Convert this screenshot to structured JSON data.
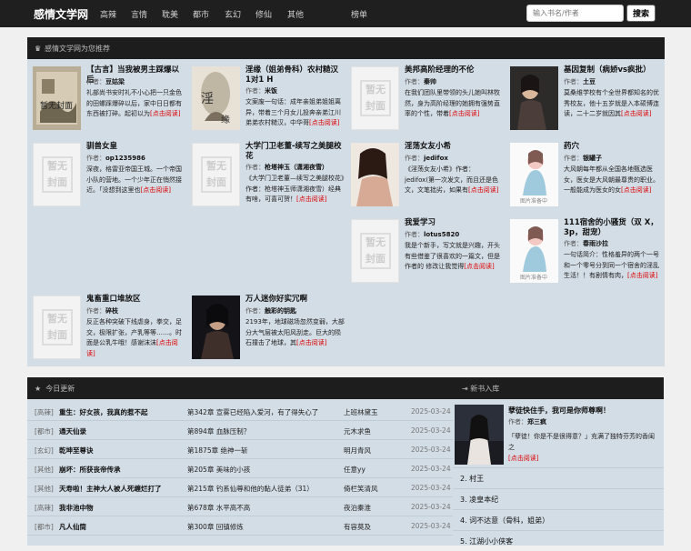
{
  "site": {
    "logo": "感情文学网"
  },
  "nav": [
    "高辣",
    "言情",
    "耽美",
    "都市",
    "玄幻",
    "修仙",
    "其他",
    "榜单"
  ],
  "search": {
    "placeholder": "输入书名/作者",
    "button": "搜索"
  },
  "recommend": {
    "heading": "感情文学网为您推荐",
    "author_label": "作者：",
    "more_label": "[点击阅读]",
    "placeholder_cover": "暂无封面",
    "books": [
      {
        "title": "【古言】当我被男主踩爆以后",
        "author": "豆姑梁",
        "desc": "礼部尚书安时礼不小心把一只金色的田螺踩爆碎以后，家中日日都有东西被打碎。起初以为",
        "cover": "drawing"
      },
      {
        "title": "淫缘（姐弟骨科）农村糙汉 1对1 H",
        "author": "米饭",
        "desc": "文案废一句话：成年亲姐弟姐姐离异，带着三个月女儿投奔亲弟江川弟弟农村糙汉，中华哥",
        "cover": "portrait"
      },
      {
        "title": "美邦高阶经理的不伦",
        "author": "秦帅",
        "desc": "在我们团队里带领的头儿她叫林牧然，身为高阶经理的她拥有强势直率的个性，带着",
        "cover": "placeholder"
      },
      {
        "title": "基因复制（病娇vs疯批）",
        "author": "土豆",
        "desc": "莫桑维学校有个全世界都知名的优秀校友，他十五岁就是入本硕博连读，二十二岁就因其",
        "cover": "photo"
      },
      {
        "title": "驯兽女皇",
        "author": "op1235986",
        "desc": "深夜，格雷亚帝国王城。一个帝国小队的营地。一个少年正在悄然接近。「没想到这里也",
        "cover": "placeholder"
      },
      {
        "title": "大学门卫老董-续写之美腿校花",
        "author": "枪塔神玉（潇湘夜雪）",
        "desc": "《大学门卫老董—续写之美腿校花》作者：枪塔神玉师潇湘夜雪）经典有啥，可喜可贺！",
        "cover": "placeholder"
      },
      {
        "title": "淫荡女友小希",
        "author": "jedifox",
        "desc": "《淫荡女友小希》作者：jedifox(第一次发文，而且还是色文，文笔拙劣，如果有",
        "cover": "photo2"
      },
      {
        "title": "药穴",
        "author": "银罐子",
        "desc": "大风朝每年都从全国各地甄选医女，医女是大风朝最尊贵的职业。一般能成为医女的女",
        "cover": "pending"
      },
      {
        "title": "我爱学习",
        "author": "lotus5820",
        "desc": "我是个新手，写文就是兴趣，开头有些借鉴了很喜欢的一篇文，但是作者的 修改让我觉得",
        "cover": "placeholder"
      },
      {
        "title": "111宿舍的小骚货（双 X，3p，甜宠）",
        "author": "春雨沙拉",
        "desc": "一句话简介：性格羞异的两个一号和一个零号分到同一个宿舍的淫乱生活！！有剧情有肉，",
        "cover": "pending"
      },
      {
        "title": "鬼畜重口堆放区",
        "author": "碎枝",
        "desc": "反正各种突破下线虐身，拳交，足交，极限扩张，产乳等等……。时面是公乳牛哦！感谢沫沫",
        "cover": "placeholder"
      },
      {
        "title": "万人迷你好实冗啊",
        "author": "触彩的钥匙",
        "desc": "2193年，地球磁场忽然变弱，大部分大气层被太阳风刮走。巨大的陨石撞击了地球，其",
        "cover": "dark"
      }
    ]
  },
  "today": {
    "heading": "今日更新",
    "rows": [
      {
        "cat": "[高辣]",
        "title": "重生：好女孩，我真的惹不起",
        "chapter": "第342章 宣雾已经陷入爱河，有了得失心了",
        "author": "上班林黛玉",
        "date": "2025-03-24"
      },
      {
        "cat": "[都市]",
        "title": "通天仙录",
        "chapter": "第894章 血脉压制？",
        "author": "元木求鱼",
        "date": "2025-03-24"
      },
      {
        "cat": "[玄幻]",
        "title": "乾坤至尊诀",
        "chapter": "第1875章 绝神一斩",
        "author": "明月青风",
        "date": "2025-03-24"
      },
      {
        "cat": "[其他]",
        "title": "崩坏：所获丧帝传承",
        "chapter": "第205章 美味的小孩",
        "author": "任意yy",
        "date": "2025-03-24"
      },
      {
        "cat": "[其他]",
        "title": "天寿啦！主神大人被人死缠烂打了",
        "chapter": "第215章 钓系仙尊和他的黏人徒弟（31）",
        "author": "倚栏笑清风",
        "date": "2025-03-24"
      },
      {
        "cat": "[高辣]",
        "title": "我非池中物",
        "chapter": "第678章 水平高不高",
        "author": "夜泊秦淮",
        "date": "2025-03-24"
      },
      {
        "cat": "[都市]",
        "title": "凡人仙筒",
        "chapter": "第300章 回镇修炼",
        "author": "有容莫及",
        "date": "2025-03-24"
      }
    ]
  },
  "newbooks": {
    "heading": "新书入库",
    "featured": {
      "title": "孽徒快住手，我可是你师尊啊！",
      "author": "郑三疯",
      "desc": "「孽徒！你是不是很得意？」充满了独特芬芳的香闺之",
      "more": "[点击阅读]"
    },
    "list": [
      "2. 村王",
      "3. 凌皇本纪",
      "4. 词不达意（骨科，姐弟）",
      "5. 江湖小小侠客"
    ]
  },
  "colors": {
    "topbar": "#1f1f1f",
    "panel": "#d3dde6",
    "link_red": "#dd0000"
  }
}
